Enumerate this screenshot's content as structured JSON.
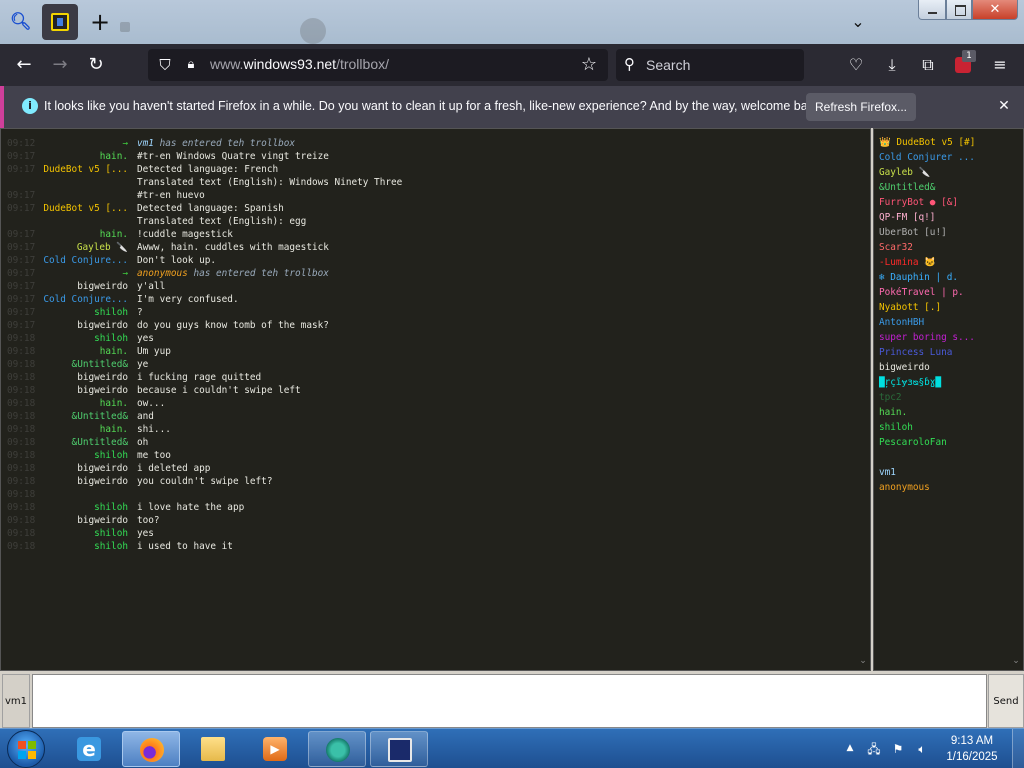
{
  "browser": {
    "url_prefix": "www.",
    "url_domain": "windows93.net",
    "url_path": "/trollbox/",
    "search_placeholder": "Search",
    "addon_badge": "1",
    "icons": [
      "search-icon",
      "tab-favicon",
      "plus-icon",
      "chevron-down-icon",
      "back-arrow-icon",
      "forward-arrow-icon",
      "reload-icon",
      "shield-icon",
      "lock-icon",
      "star-icon",
      "pocket-icon",
      "download-icon",
      "extensions-icon",
      "addon-icon",
      "hamburger-menu-icon"
    ]
  },
  "notification": {
    "text": "It looks like you haven't started Firefox in a while. Do you want to clean it up for a fresh, like-new experience? And by the way, welcome back!",
    "button": "Refresh Firefox...",
    "close_icon": "close-icon"
  },
  "chat": {
    "messages": [
      {
        "time": "09:12",
        "nick": "→",
        "nick_color": "#3fcf3f",
        "text": "vm1 has entered teh trollbox",
        "system": true,
        "user": "vm1",
        "user_color": "#9fd7ff"
      },
      {
        "time": "09:17",
        "nick": "hain.",
        "nick_color": "#55dd55",
        "text": "#tr-en Windows Quatre vingt treize"
      },
      {
        "time": "09:17",
        "nick": "DudeBot v5 [...",
        "nick_color": "#f2c200",
        "text": "Detected language: French"
      },
      {
        "time": "",
        "nick": "",
        "nick_color": "#f2c200",
        "text": "Translated text (English): Windows Ninety Three"
      },
      {
        "time": "09:17",
        "nick": "",
        "nick_color": "#55dd55",
        "text": "#tr-en huevo"
      },
      {
        "time": "09:17",
        "nick": "DudeBot v5 [...",
        "nick_color": "#f2c200",
        "text": "Detected language: Spanish"
      },
      {
        "time": "",
        "nick": "",
        "nick_color": "#f2c200",
        "text": "Translated text (English): egg"
      },
      {
        "time": "09:17",
        "nick": "hain.",
        "nick_color": "#55dd55",
        "text": "!cuddle magestick"
      },
      {
        "time": "09:17",
        "nick": "Gayleb 🔪",
        "nick_color": "#c8e04a",
        "text": "Awww, hain. cuddles with magestick"
      },
      {
        "time": "09:17",
        "nick": "Cold Conjure...",
        "nick_color": "#3a9ae8",
        "text": "Don't look up."
      },
      {
        "time": "09:17",
        "nick": "→",
        "nick_color": "#3fcf3f",
        "text": "anonymous has entered teh trollbox",
        "system": true,
        "user": "anonymous",
        "user_color": "#f0a020"
      },
      {
        "time": "09:17",
        "nick": "bigweirdo",
        "nick_color": "#e8e8e0",
        "text": "y'all"
      },
      {
        "time": "09:17",
        "nick": "Cold Conjure...",
        "nick_color": "#3a9ae8",
        "text": "I'm very confused."
      },
      {
        "time": "09:17",
        "nick": "shiloh",
        "nick_color": "#33dd55",
        "text": "?"
      },
      {
        "time": "09:17",
        "nick": "bigweirdo",
        "nick_color": "#e8e8e0",
        "text": "do you guys know tomb of the mask?"
      },
      {
        "time": "09:18",
        "nick": "shiloh",
        "nick_color": "#33dd55",
        "text": "yes"
      },
      {
        "time": "09:18",
        "nick": "hain.",
        "nick_color": "#55dd55",
        "text": "Um yup"
      },
      {
        "time": "09:18",
        "nick": "&Untitled&",
        "nick_color": "#4fcf6f",
        "text": "ye"
      },
      {
        "time": "09:18",
        "nick": "bigweirdo",
        "nick_color": "#e8e8e0",
        "text": "i fucking rage quitted"
      },
      {
        "time": "09:18",
        "nick": "bigweirdo",
        "nick_color": "#e8e8e0",
        "text": "because i couldn't swipe left"
      },
      {
        "time": "09:18",
        "nick": "hain.",
        "nick_color": "#55dd55",
        "text": "ow..."
      },
      {
        "time": "09:18",
        "nick": "&Untitled&",
        "nick_color": "#4fcf6f",
        "text": "and"
      },
      {
        "time": "09:18",
        "nick": "hain.",
        "nick_color": "#55dd55",
        "text": "shi..."
      },
      {
        "time": "09:18",
        "nick": "&Untitled&",
        "nick_color": "#4fcf6f",
        "text": "oh"
      },
      {
        "time": "09:18",
        "nick": "shiloh",
        "nick_color": "#33dd55",
        "text": "me too"
      },
      {
        "time": "09:18",
        "nick": "bigweirdo",
        "nick_color": "#e8e8e0",
        "text": "i deleted app"
      },
      {
        "time": "09:18",
        "nick": "bigweirdo",
        "nick_color": "#e8e8e0",
        "text": "you couldn't swipe left?"
      },
      {
        "time": "09:18",
        "nick": "",
        "nick_color": "#33dd55",
        "text": ""
      },
      {
        "time": "09:18",
        "nick": "shiloh",
        "nick_color": "#33dd55",
        "text": "i love hate the app"
      },
      {
        "time": "09:18",
        "nick": "bigweirdo",
        "nick_color": "#e8e8e0",
        "text": "too?"
      },
      {
        "time": "09:18",
        "nick": "shiloh",
        "nick_color": "#33dd55",
        "text": "yes"
      },
      {
        "time": "09:18",
        "nick": "shiloh",
        "nick_color": "#33dd55",
        "text": "i used to have it"
      }
    ]
  },
  "users": [
    {
      "name": "👑 DudeBot v5 [#]",
      "color": "#f2c200"
    },
    {
      "name": "Cold Conjurer ...",
      "color": "#3a9ae8"
    },
    {
      "name": "Gayleb 🔪",
      "color": "#c8e04a"
    },
    {
      "name": "&Untitled&",
      "color": "#4fcf6f"
    },
    {
      "name": "FurryBot ● [&]",
      "color": "#ff5577"
    },
    {
      "name": "QP-FM [q!]",
      "color": "#ffb0d0"
    },
    {
      "name": "UberBot [u!]",
      "color": "#b0b0b0"
    },
    {
      "name": "Scar32",
      "color": "#ff6a6a"
    },
    {
      "name": "-Lumina 🐱",
      "color": "#ff2a2a"
    },
    {
      "name": "❄ Dauphin | d.",
      "color": "#3ab0ff"
    },
    {
      "name": "PokéTravel | p.",
      "color": "#ff6ab0"
    },
    {
      "name": "Nyabott [.]",
      "color": "#f2c200"
    },
    {
      "name": "AntonHBH",
      "color": "#3a9ae8"
    },
    {
      "name": "super boring s...",
      "color": "#c020d0"
    },
    {
      "name": "Princess Luna",
      "color": "#4a5ad8"
    },
    {
      "name": "bigweirdo",
      "color": "#e8e8e0"
    },
    {
      "name": "█ŗçĩɏɜᴓ§ɓɣ█",
      "color": "#00e0e0"
    },
    {
      "name": "tpc2",
      "color": "#2a6a3a"
    },
    {
      "name": "hain.",
      "color": "#55dd55"
    },
    {
      "name": "shiloh",
      "color": "#33dd55"
    },
    {
      "name": "PescaroloFan",
      "color": "#33dd55"
    },
    {
      "name": "",
      "color": "#e8e8e0"
    },
    {
      "name": "vm1",
      "color": "#9fd7ff"
    },
    {
      "name": "anonymous",
      "color": "#f0a020"
    }
  ],
  "input": {
    "nick": "vm1",
    "value": "",
    "send": "Send"
  },
  "taskbar": {
    "apps": [
      {
        "name": "internet-explorer",
        "icon": "ie-icon",
        "state": "normal"
      },
      {
        "name": "firefox",
        "icon": "firefox-icon",
        "state": "active"
      },
      {
        "name": "file-explorer",
        "icon": "folder-icon",
        "state": "normal"
      },
      {
        "name": "media-player",
        "icon": "media-icon",
        "state": "normal"
      },
      {
        "name": "app-lvn",
        "icon": "lvn-icon",
        "state": "running"
      },
      {
        "name": "windows93",
        "icon": "win93-icon",
        "state": "running"
      }
    ],
    "time": "9:13 AM",
    "date": "1/16/2025"
  }
}
